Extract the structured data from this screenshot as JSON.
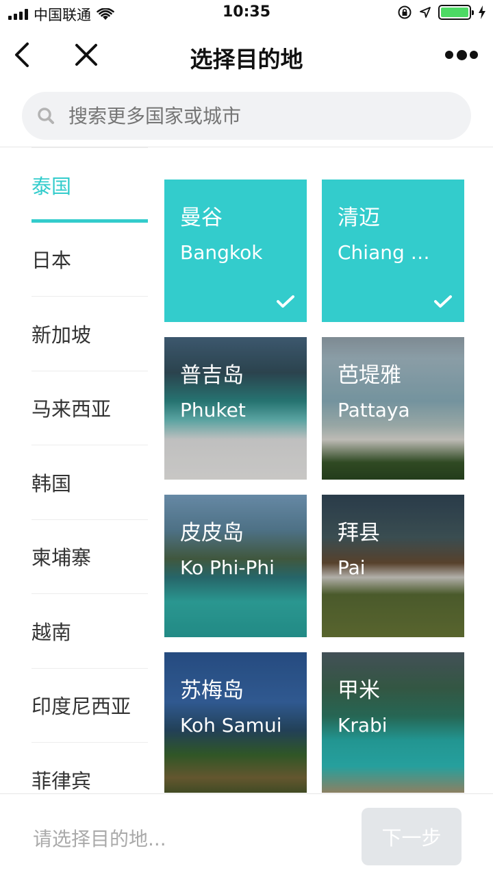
{
  "status_bar": {
    "carrier": "中国联通",
    "time": "10:35"
  },
  "nav": {
    "title": "选择目的地"
  },
  "search": {
    "placeholder": "搜索更多国家或城市"
  },
  "sidebar": {
    "items": [
      {
        "label": "泰国",
        "active": true
      },
      {
        "label": "日本"
      },
      {
        "label": "新加坡"
      },
      {
        "label": "马来西亚"
      },
      {
        "label": "韩国"
      },
      {
        "label": "柬埔寨"
      },
      {
        "label": "越南"
      },
      {
        "label": "印度尼西亚"
      },
      {
        "label": "菲律宾"
      }
    ]
  },
  "destinations": [
    {
      "cn": "曼谷",
      "en": "Bangkok",
      "selected": true
    },
    {
      "cn": "清迈",
      "en": "Chiang …",
      "selected": true
    },
    {
      "cn": "普吉岛",
      "en": "Phuket"
    },
    {
      "cn": "芭堤雅",
      "en": "Pattaya"
    },
    {
      "cn": "皮皮岛",
      "en": "Ko Phi-Phi"
    },
    {
      "cn": "拜县",
      "en": "Pai"
    },
    {
      "cn": "苏梅岛",
      "en": "Koh Samui"
    },
    {
      "cn": "甲米",
      "en": "Krabi"
    }
  ],
  "bottom": {
    "hint": "请选择目的地...",
    "next_label": "下一步"
  },
  "colors": {
    "accent": "#33cccc",
    "battery": "#4cd964",
    "button_disabled": "#e3e6e9"
  }
}
